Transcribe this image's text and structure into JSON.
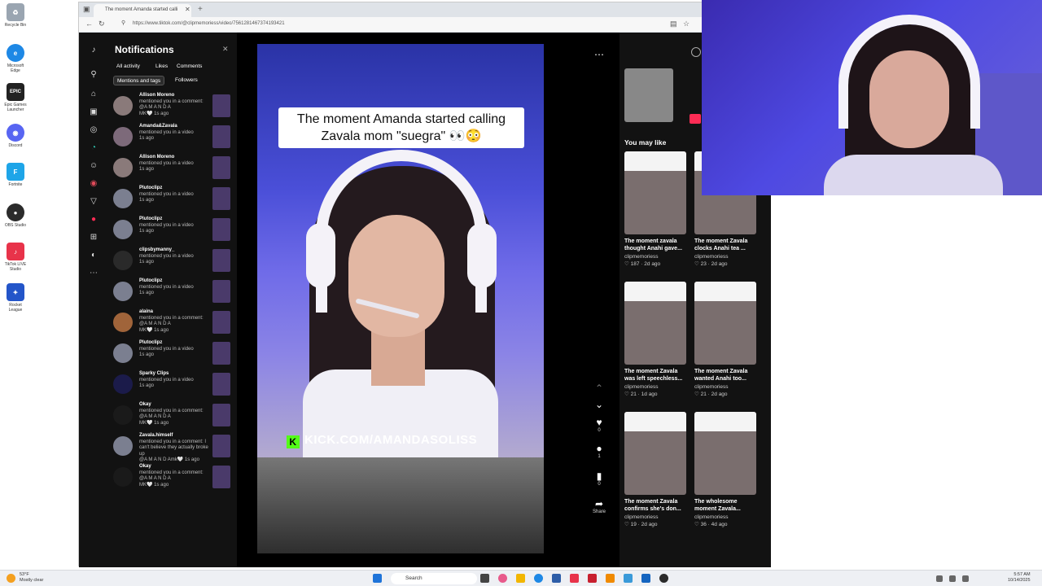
{
  "desktop": {
    "icons": [
      {
        "label": "Recycle Bin",
        "color": "#9aa5b1",
        "glyph": "♻"
      },
      {
        "label": "Microsoft Edge",
        "color": "#1e88e5",
        "glyph": "e"
      },
      {
        "label": "Epic Games Launcher",
        "color": "#222222",
        "glyph": "EPIC"
      },
      {
        "label": "Discord",
        "color": "#5865f2",
        "glyph": "◉"
      },
      {
        "label": "Fortnite",
        "color": "#1ea5e8",
        "glyph": "F"
      },
      {
        "label": "OBS Studio",
        "color": "#2b2b2b",
        "glyph": "●"
      },
      {
        "label": "TikTok LIVE Studio",
        "color": "#e8334a",
        "glyph": "♪"
      },
      {
        "label": "Rocket League",
        "color": "#2355c9",
        "glyph": "✦"
      }
    ]
  },
  "browser": {
    "tab_title": "The moment Amanda started calli",
    "url": "https://www.tiktok.com/@clipmemoriess/video/7561281467374193421"
  },
  "notifications": {
    "title": "Notifications",
    "filters": [
      "All activity",
      "Likes",
      "Comments",
      "Mentions and tags",
      "Followers"
    ],
    "active_filter": "Mentions and tags",
    "items": [
      {
        "name": "Allison Moreno",
        "text": "mentioned you in a comment: @A M A N D A",
        "extra": "MK🤍 1s ago",
        "avatar_color": "#8a7a7a"
      },
      {
        "name": "Amanda&Zavala",
        "text": "mentioned you in a video",
        "extra": "1s ago",
        "avatar_color": "#7d6a7a"
      },
      {
        "name": "Allison Moreno",
        "text": "mentioned you in a video",
        "extra": "1s ago",
        "avatar_color": "#8a7a7a"
      },
      {
        "name": "Plutoclipz",
        "text": "mentioned you in a video",
        "extra": "1s ago",
        "avatar_color": "#7b7f90"
      },
      {
        "name": "Plutoclipz",
        "text": "mentioned you in a video",
        "extra": "1s ago",
        "avatar_color": "#7b7f90"
      },
      {
        "name": "clipsbymanny_",
        "text": "mentioned you in a video",
        "extra": "1s ago",
        "avatar_color": "#2a2a2a"
      },
      {
        "name": "Plutoclipz",
        "text": "mentioned you in a video",
        "extra": "1s ago",
        "avatar_color": "#7b7f90"
      },
      {
        "name": "alaina",
        "text": "mentioned you in a comment: @A M A N D A",
        "extra": "MK🤍 1s ago",
        "avatar_color": "#a0643a"
      },
      {
        "name": "Plutoclipz",
        "text": "mentioned you in a video",
        "extra": "1s ago",
        "avatar_color": "#7b7f90"
      },
      {
        "name": "Sparky Clips",
        "text": "mentioned you in a video",
        "extra": "1s ago",
        "avatar_color": "#1b1b4a"
      },
      {
        "name": "Okay",
        "text": "mentioned you in a comment: @A M A N D A",
        "extra": "MK🤍 1s ago",
        "avatar_color": "#1a1a1a"
      },
      {
        "name": "Zavala.himself",
        "text": "mentioned you in a comment: I can't believe they actually broke up",
        "extra": "@A M A N D Amk🤍 1s ago",
        "avatar_color": "#7b7f90"
      },
      {
        "name": "Okay",
        "text": "mentioned you in a comment: @A M A N D A",
        "extra": "MK🤍 1s ago",
        "avatar_color": "#1a1a1a"
      }
    ]
  },
  "video": {
    "caption": "The moment Amanda started calling Zavala mom \"suegra\" 👀😳",
    "watermark": "KICK.COM/AMANDASOLISS"
  },
  "actions": {
    "like_count": "0",
    "comment_count": "1",
    "save_count": "0",
    "share_label": "Share"
  },
  "sidebar": {
    "you_may_like": "You may like",
    "cards": [
      {
        "title": "The moment zavala thought Anahi gave...",
        "author": "clipmemoriess",
        "likes": "187",
        "age": "2d ago"
      },
      {
        "title": "The moment Zavala clocks Anahi tea ...",
        "author": "clipmemoriess",
        "likes": "23",
        "age": "2d ago"
      },
      {
        "title": "The moment Zavala was left speechless...",
        "author": "clipmemoriess",
        "likes": "21",
        "age": "1d ago"
      },
      {
        "title": "The moment Zavala wanted Anahi too...",
        "author": "clipmemoriess",
        "likes": "21",
        "age": "2d ago"
      },
      {
        "title": "The moment Zavala confirms she's don...",
        "author": "clipmemoriess",
        "likes": "19",
        "age": "2d ago"
      },
      {
        "title": "The wholesome moment Zavala...",
        "author": "clipmemoriess",
        "likes": "36",
        "age": "4d ago"
      }
    ]
  },
  "taskbar": {
    "search_label": "Search",
    "weather_temp": "53°F",
    "weather_desc": "Mostly clear",
    "time": "5:57 AM",
    "date": "10/14/2025"
  }
}
